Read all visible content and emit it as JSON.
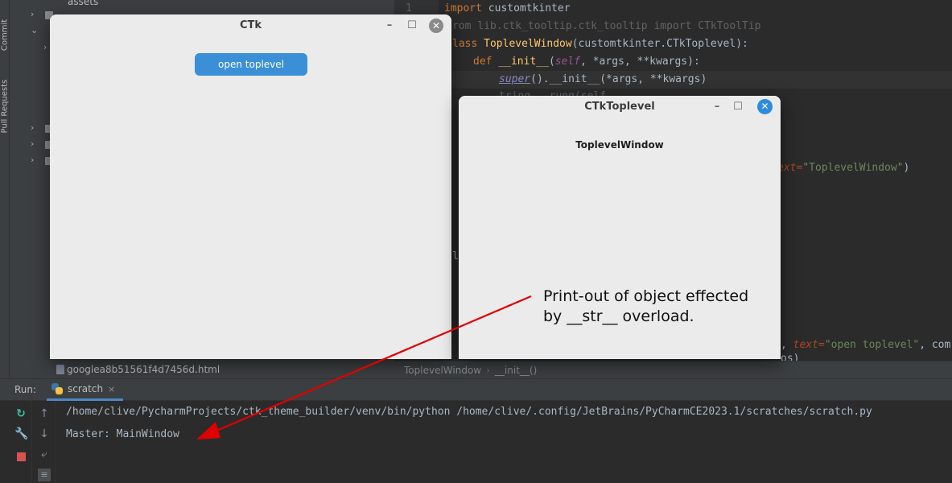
{
  "sidebar_strip": {
    "commit_label": "Commit",
    "pull_requests_label": "Pull Requests"
  },
  "project_tree": {
    "top_item": "assets",
    "bottom_file": "googlea8b51561f4d7456d.html"
  },
  "editor": {
    "line_number": "1",
    "lines": {
      "l1_kw": "import",
      "l1_mod": " customtkinter",
      "l2": "rom lib.ctk_tooltip.ctk_tooltip import CTkToolTip",
      "l3_kw": "lass ",
      "l3_name": "ToplevelWindow",
      "l3_rest": "(customtkinter.CTkToplevel):",
      "l4_kw": "def ",
      "l4_name": "__init__",
      "l4_paren": "(",
      "l4_self": "self",
      "l4_rest": ", *args, **kwargs):",
      "l5_super": "super",
      "l5_rest": "().__init__(*args, **kwargs)",
      "l6_partial": "tring...rung(self",
      "l7_kw": "ext=",
      "l7_str": "\"ToplevelWindow\"",
      "l7_close": ")",
      "l8": "l",
      "l9_pre": ", ",
      "l9_kw": "text=",
      "l9_str": "\"open toplevel\"",
      "l9_rest": ", com",
      "l10": "os)"
    }
  },
  "breadcrumb": {
    "class_name": "ToplevelWindow",
    "method_name": "__init__()"
  },
  "run_panel": {
    "run_label": "Run:",
    "tab_name": "scratch",
    "tab_close": "×",
    "command_line": "/home/clive/PycharmProjects/ctk_theme_builder/venv/bin/python /home/clive/.config/JetBrains/PyCharmCE2023.1/scratches/scratch.py",
    "output_line": "Master: MainWindow"
  },
  "ctk_window": {
    "title": "CTk",
    "button_label": "open toplevel",
    "minimize": "–",
    "maximize": "☐",
    "close": "✕"
  },
  "toplevel_window": {
    "title": "CTkToplevel",
    "label": "ToplevelWindow",
    "minimize": "–",
    "maximize": "☐",
    "close": "✕"
  },
  "annotation": {
    "line1": "Print-out of object effected",
    "line2": "by __str__ overload."
  },
  "colors": {
    "ide_dark": "#2b2b2b",
    "panel": "#3c3f41",
    "window_bg": "#ebebeb",
    "button_blue": "#3a8fd6",
    "close_blue": "#2d8ce0",
    "arrow_red": "#e00000"
  },
  "icons": [
    "rerun-icon",
    "wrench-icon",
    "stop-icon",
    "up-arrow-icon",
    "down-arrow-icon",
    "wrap-icon",
    "align-icon",
    "python-file-icon"
  ]
}
